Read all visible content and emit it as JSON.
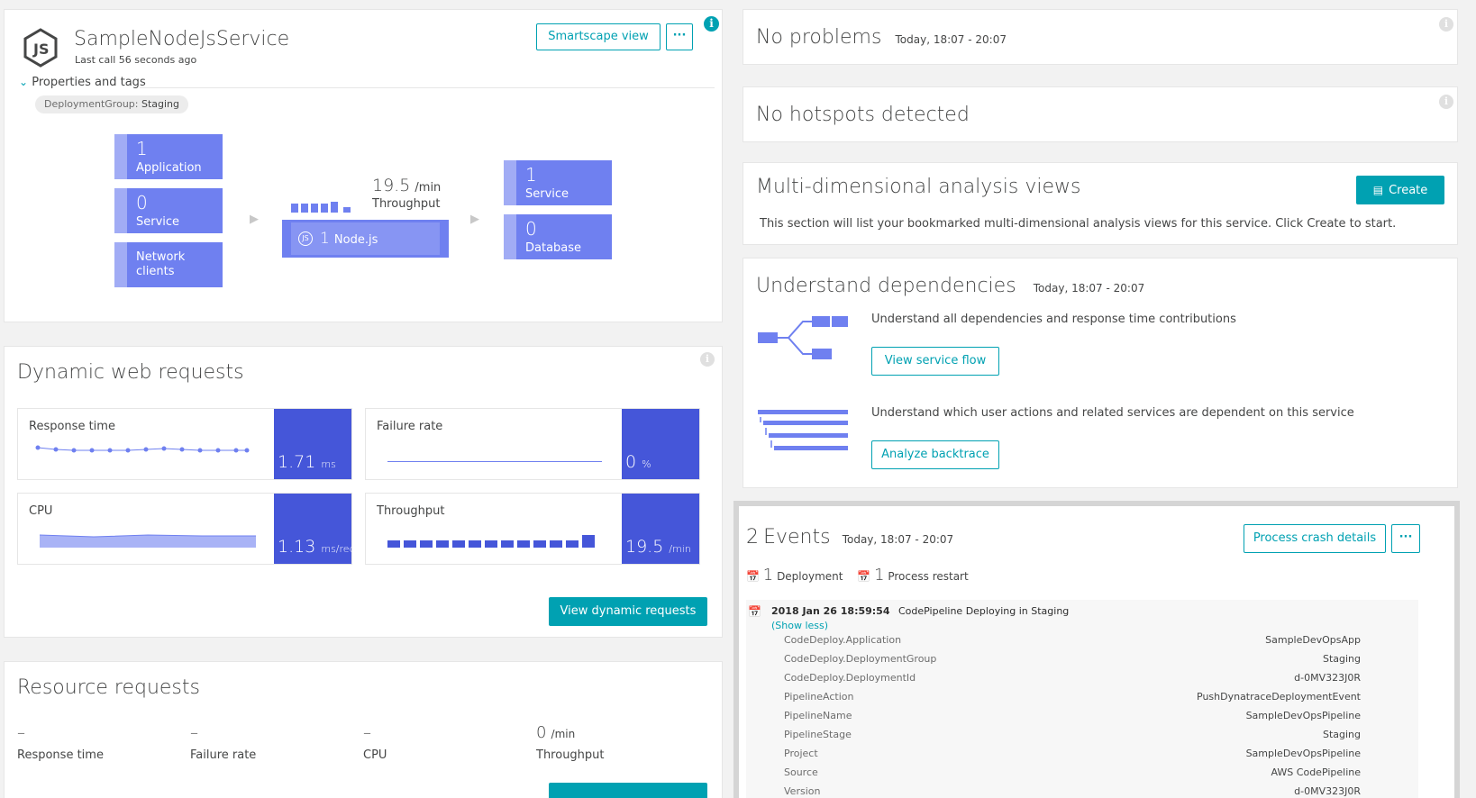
{
  "service": {
    "name": "SampleNodeJsService",
    "last_call": "Last call 56 seconds ago",
    "smartscape_button": "Smartscape view",
    "more_button": "···",
    "properties_label": "Properties and tags",
    "tag_key": "DeploymentGroup:",
    "tag_value": "Staging"
  },
  "topology": {
    "callers": [
      {
        "count": "1",
        "label": "Application"
      },
      {
        "count": "0",
        "label": "Service"
      },
      {
        "count": "",
        "label": "Network clients"
      }
    ],
    "throughput_value": "19.5",
    "throughput_unit": "/min",
    "throughput_label": "Throughput",
    "process_count": "1",
    "process_label": "Node.js",
    "callees": [
      {
        "count": "1",
        "label": "Service"
      },
      {
        "count": "0",
        "label": "Database"
      }
    ]
  },
  "dynamic_requests": {
    "title": "Dynamic web requests",
    "response_time_label": "Response time",
    "response_time_value": "1.71",
    "response_time_unit": "ms",
    "failure_rate_label": "Failure rate",
    "failure_rate_value": "0",
    "failure_rate_unit": "%",
    "cpu_label": "CPU",
    "cpu_value": "1.13",
    "cpu_unit": "ms/req",
    "throughput_label": "Throughput",
    "throughput_value": "19.5",
    "throughput_unit": "/min",
    "view_button": "View dynamic requests"
  },
  "resource_requests": {
    "title": "Resource requests",
    "cols": [
      {
        "value": "–",
        "unit": "",
        "label": "Response time"
      },
      {
        "value": "–",
        "unit": "",
        "label": "Failure rate"
      },
      {
        "value": "–",
        "unit": "",
        "label": "CPU"
      },
      {
        "value": "0",
        "unit": "/min",
        "label": "Throughput"
      }
    ]
  },
  "problems": {
    "title": "No problems",
    "time": "Today, 18:07 - 20:07"
  },
  "hotspots": {
    "title": "No hotspots detected"
  },
  "mda": {
    "title": "Multi-dimensional analysis views",
    "create_button": "Create",
    "description": "This section will list your bookmarked multi-dimensional analysis views for this service. Click Create to start."
  },
  "dependencies": {
    "title": "Understand dependencies",
    "time": "Today, 18:07 - 20:07",
    "flow_text": "Understand all dependencies and response time contributions",
    "flow_button": "View service flow",
    "backtrace_text": "Understand which user actions and related services are dependent on this service",
    "backtrace_button": "Analyze backtrace"
  },
  "events": {
    "count": "2",
    "title": "Events",
    "time": "Today, 18:07 - 20:07",
    "crash_button": "Process crash details",
    "more_button": "···",
    "summary": [
      {
        "count": "1",
        "label": "Deployment"
      },
      {
        "count": "1",
        "label": "Process restart"
      }
    ],
    "entry_time": "2018 Jan 26 18:59:54",
    "entry_title": "CodePipeline Deploying in Staging",
    "show_less": "(Show less)",
    "properties": [
      {
        "key": "CodeDeploy.Application",
        "value": "SampleDevOpsApp"
      },
      {
        "key": "CodeDeploy.DeploymentGroup",
        "value": "Staging"
      },
      {
        "key": "CodeDeploy.DeploymentId",
        "value": "d-0MV323J0R"
      },
      {
        "key": "PipelineAction",
        "value": "PushDynatraceDeploymentEvent"
      },
      {
        "key": "PipelineName",
        "value": "SampleDevOpsPipeline"
      },
      {
        "key": "PipelineStage",
        "value": "Staging"
      },
      {
        "key": "Project",
        "value": "SampleDevOpsPipeline"
      },
      {
        "key": "Source",
        "value": "AWS CodePipeline"
      },
      {
        "key": "Version",
        "value": "d-0MV323J0R"
      }
    ]
  },
  "colors": {
    "accent": "#00a1b2",
    "tile": "#6f80f0",
    "metric": "#4556d9"
  }
}
